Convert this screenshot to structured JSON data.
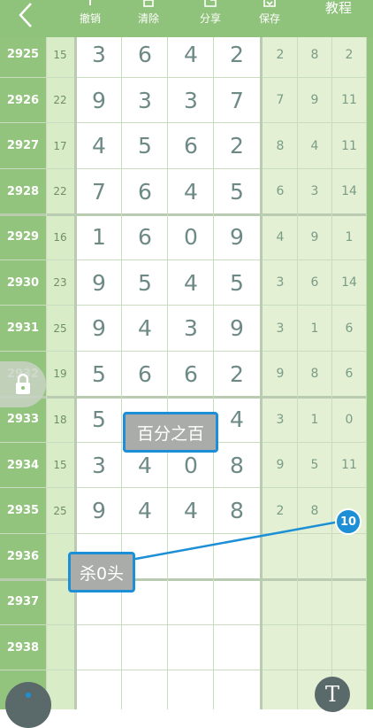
{
  "toolbar": {
    "undo": "撤销",
    "clear": "清除",
    "share": "分享",
    "save": "保存",
    "tutorial": "教程"
  },
  "rows": [
    {
      "period": "2925",
      "sum": "15",
      "digits": [
        "3",
        "6",
        "4",
        "2"
      ],
      "extra": [
        "2",
        "8",
        "2"
      ]
    },
    {
      "period": "2926",
      "sum": "22",
      "digits": [
        "9",
        "3",
        "3",
        "7"
      ],
      "extra": [
        "7",
        "9",
        "11"
      ]
    },
    {
      "period": "2927",
      "sum": "17",
      "digits": [
        "4",
        "5",
        "6",
        "2"
      ],
      "extra": [
        "8",
        "4",
        "11"
      ]
    },
    {
      "period": "2928",
      "sum": "22",
      "digits": [
        "7",
        "6",
        "4",
        "5"
      ],
      "extra": [
        "6",
        "3",
        "14"
      ]
    },
    {
      "period": "2929",
      "sum": "16",
      "digits": [
        "1",
        "6",
        "0",
        "9"
      ],
      "extra": [
        "4",
        "9",
        "1"
      ]
    },
    {
      "period": "2930",
      "sum": "23",
      "digits": [
        "9",
        "5",
        "4",
        "5"
      ],
      "extra": [
        "3",
        "6",
        "14"
      ]
    },
    {
      "period": "2931",
      "sum": "25",
      "digits": [
        "9",
        "4",
        "3",
        "9"
      ],
      "extra": [
        "3",
        "1",
        "6"
      ]
    },
    {
      "period": "2932",
      "sum": "19",
      "digits": [
        "5",
        "6",
        "6",
        "2"
      ],
      "extra": [
        "9",
        "8",
        "6"
      ]
    },
    {
      "period": "2933",
      "sum": "18",
      "digits": [
        "5",
        "",
        "",
        "4"
      ],
      "extra": [
        "3",
        "1",
        "0"
      ]
    },
    {
      "period": "2934",
      "sum": "15",
      "digits": [
        "3",
        "4",
        "0",
        "8"
      ],
      "extra": [
        "9",
        "5",
        "11"
      ]
    },
    {
      "period": "2935",
      "sum": "25",
      "digits": [
        "9",
        "4",
        "4",
        "8"
      ],
      "extra": [
        "2",
        "8",
        ""
      ]
    },
    {
      "period": "2936",
      "sum": "",
      "digits": [
        "",
        "",
        "",
        ""
      ],
      "extra": [
        "",
        "",
        ""
      ]
    },
    {
      "period": "2937",
      "sum": "",
      "digits": [
        "",
        "",
        "",
        ""
      ],
      "extra": [
        "",
        "",
        ""
      ]
    },
    {
      "period": "2938",
      "sum": "",
      "digits": [
        "",
        "",
        "",
        ""
      ],
      "extra": [
        "",
        "",
        ""
      ]
    }
  ],
  "annotations": {
    "tag_1": "百分之百",
    "tag_2": "杀0头",
    "badge": "10"
  },
  "fab_right_label": "T",
  "colors": {
    "toolbar_green": "#8fc27a",
    "annotation_blue": "#1d8fd6"
  }
}
